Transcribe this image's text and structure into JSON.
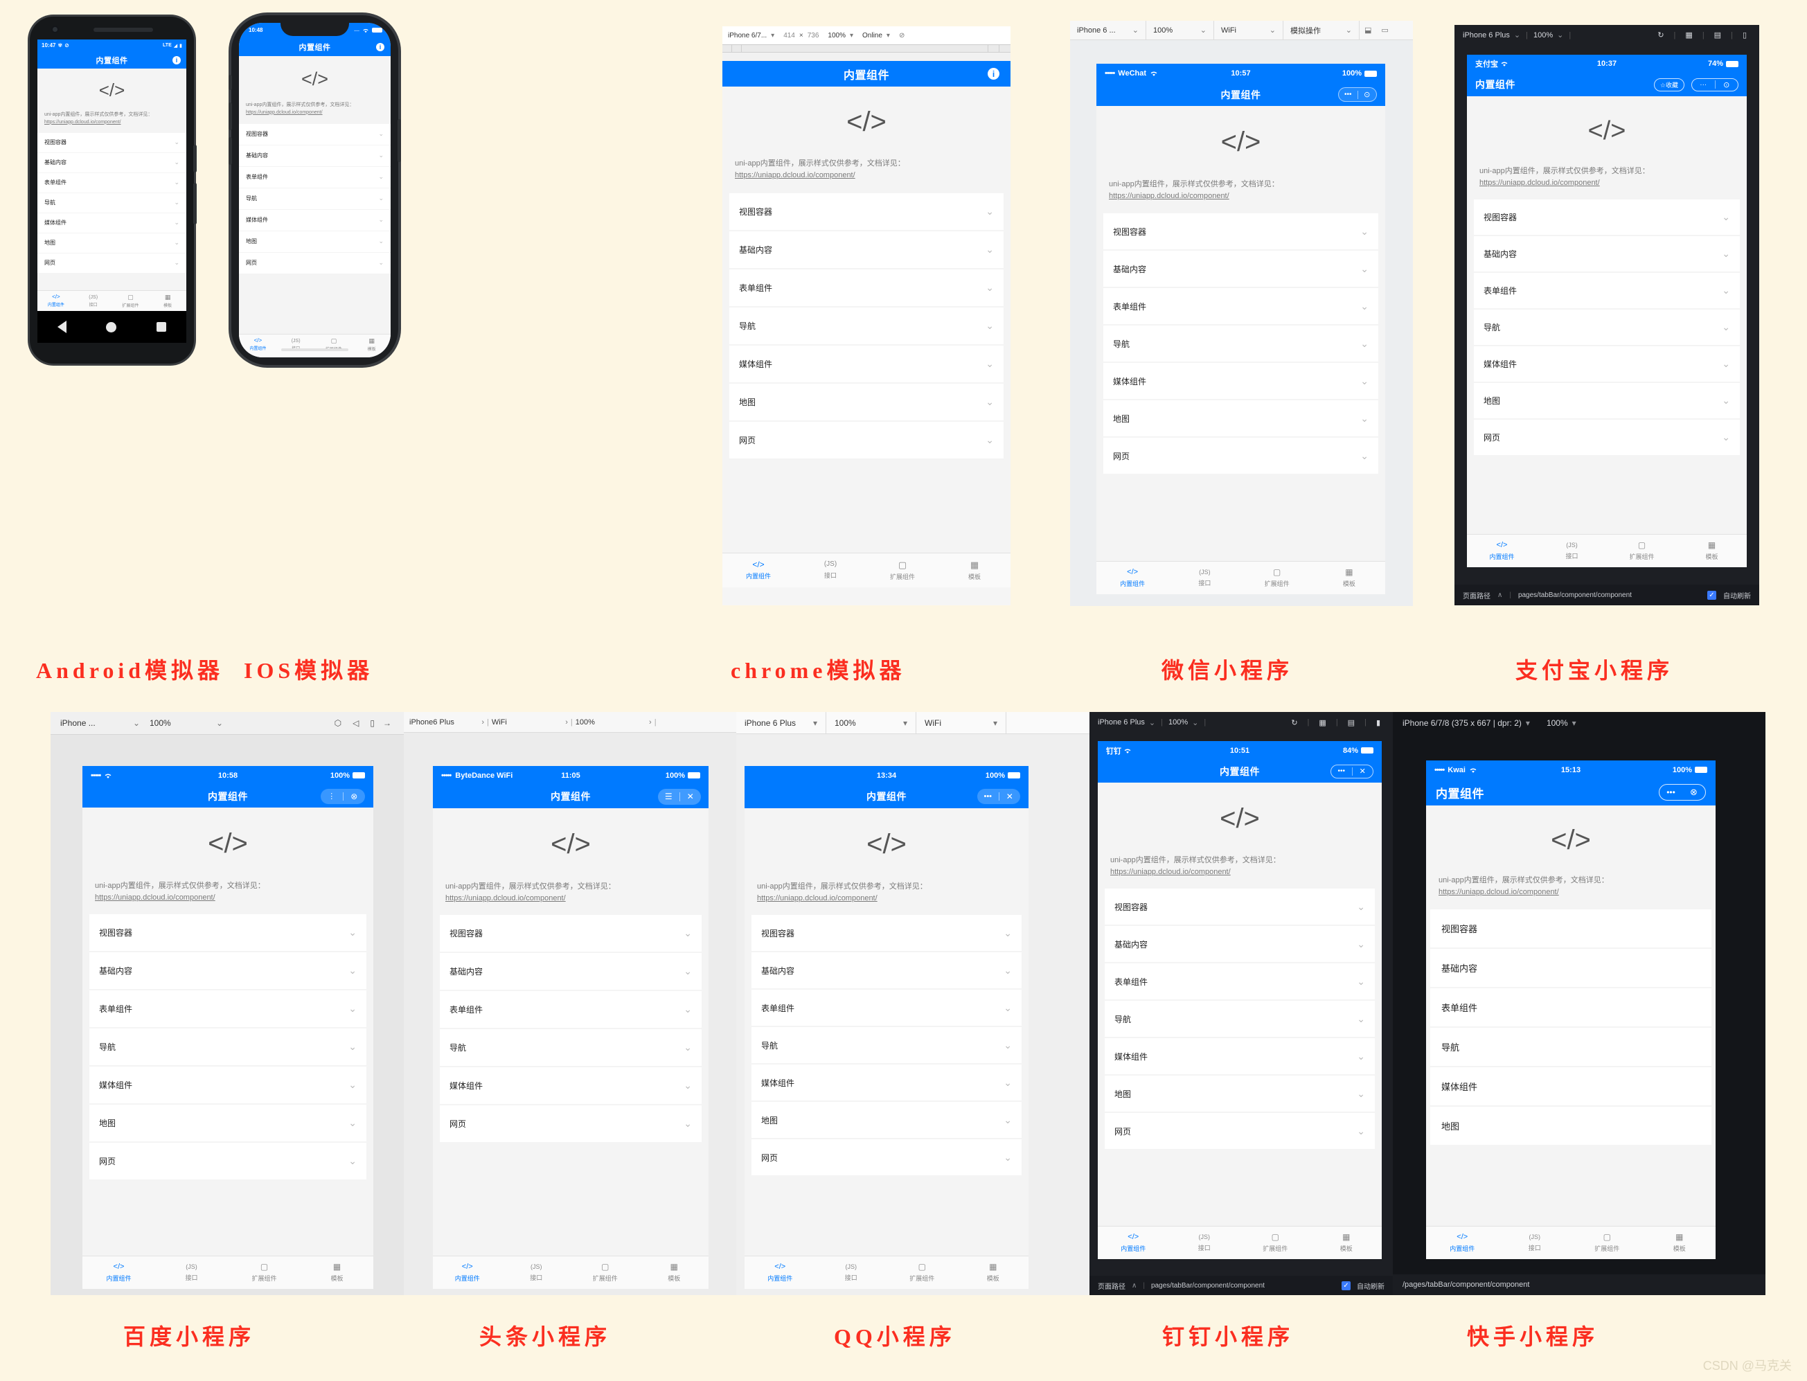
{
  "page": {
    "background": "#fdf6e3",
    "watermark": "CSDN @马克关",
    "accent": "#007AFF",
    "caption_color": "#fb2e20"
  },
  "common": {
    "app_title": "内置组件",
    "code_logo": "</>",
    "blurb_text": "uni-app内置组件，展示样式仅供参考，文档详见：",
    "blurb_link": "https://uniapp.dcloud.io/component/",
    "info_icon": "i",
    "chevron": "⌄",
    "list_items": [
      "视图容器",
      "基础内容",
      "表单组件",
      "导航",
      "媒体组件",
      "地图",
      "网页"
    ],
    "list_items_short": [
      "视图容器",
      "基础内容",
      "表单组件",
      "导航",
      "媒体组件",
      "地图"
    ],
    "tabs": [
      {
        "icon": "</>",
        "label": "内置组件",
        "active": true
      },
      {
        "icon": "(JS)",
        "label": "接口",
        "active": false
      },
      {
        "icon": "puzzle",
        "label": "扩展组件",
        "active": false
      },
      {
        "icon": "grid",
        "label": "模板",
        "active": false
      }
    ]
  },
  "captions": {
    "android": "Android模拟器",
    "ios": "IOS模拟器",
    "chrome": "chrome模拟器",
    "wechat": "微信小程序",
    "alipay": "支付宝小程序",
    "baidu": "百度小程序",
    "toutiao": "头条小程序",
    "qq": "QQ小程序",
    "dingtalk": "钉钉小程序",
    "kwai": "快手小程序"
  },
  "android": {
    "status": {
      "time": "10:47",
      "gear_icon": "✾",
      "sync_icon": "⊘",
      "network": "LTE",
      "signal_icon": "◢",
      "battery_icon": "▮"
    }
  },
  "ios": {
    "status": {
      "time": "10:48",
      "dots": "....",
      "wifi_icon": "wifi",
      "battery_icon": "▰"
    }
  },
  "chrome": {
    "toolbar": {
      "device": "iPhone 6/7...",
      "width": "414",
      "times": "×",
      "height": "736",
      "zoom": "100%",
      "network": "Online",
      "throttle_icon": "⊘"
    }
  },
  "wechat": {
    "toolbar": {
      "device": "iPhone 6 ...",
      "zoom": "100%",
      "network": "WiFi",
      "simulate": "模拟操作",
      "icon_a": "⬓",
      "icon_b": "▭"
    },
    "status": {
      "dots": "•••••",
      "carrier": "WeChat",
      "wifi_icon": "wifi",
      "time": "10:57",
      "battery": "100%",
      "battery_icon": "▰"
    },
    "capsule": {
      "more": "•••",
      "close": "⊙"
    }
  },
  "alipay": {
    "toolbar": {
      "device": "iPhone 6 Plus",
      "zoom": "100%",
      "refresh_icon": "↻",
      "grid_icon": "▦",
      "debug_icon": "▤",
      "window_icon": "▯"
    },
    "status": {
      "carrier": "支付宝",
      "wifi_icon": "wifi",
      "time": "10:37",
      "battery": "74%",
      "battery_icon": "▰"
    },
    "nav": {
      "favorite": "☆收藏",
      "more": "···",
      "close": "⊙"
    },
    "bottom": {
      "label": "页面路径",
      "caret": "∧",
      "path": "pages/tabBar/component/component",
      "refresh_label": "自动刷新",
      "checked": true
    }
  },
  "baidu": {
    "toolbar": {
      "device": "iPhone ...",
      "zoom": "100%",
      "icon_cube": "⬡",
      "icon_sound": "◁",
      "icon_phone": "▯",
      "icon_arrow": "→"
    },
    "status": {
      "dots": "•••••",
      "wifi_icon": "wifi",
      "time": "10:58",
      "battery": "100%",
      "battery_icon": "▰"
    },
    "capsule": {
      "more": "⋮",
      "close": "⊗"
    }
  },
  "toutiao": {
    "toolbar": {
      "device": "iPhone6 Plus",
      "network": "WiFi",
      "zoom": "100%",
      "sep": "›"
    },
    "status": {
      "dots": "•••••",
      "carrier": "ByteDance WiFi",
      "time": "11:05",
      "battery": "100%",
      "battery_icon": "▰"
    },
    "capsule": {
      "menu": "☰",
      "close": "✕"
    }
  },
  "qq": {
    "toolbar": {
      "device": "iPhone 6 Plus",
      "zoom": "100%",
      "network": "WiFi"
    },
    "status": {
      "time": "13:34",
      "battery": "100%",
      "battery_icon": "▰"
    },
    "capsule": {
      "more": "•••",
      "close": "✕"
    }
  },
  "dingtalk": {
    "toolbar": {
      "device": "iPhone 6 Plus",
      "zoom": "100%",
      "refresh_icon": "↻",
      "grid_icon": "▦",
      "debug_icon": "▤",
      "window_icon": "▮"
    },
    "status": {
      "carrier": "钉钉",
      "wifi_icon": "wifi",
      "time": "10:51",
      "battery": "84%",
      "battery_icon": "▰"
    },
    "capsule": {
      "more": "•••",
      "close": "✕"
    },
    "bottom": {
      "label": "页面路径",
      "caret": "∧",
      "path": "pages/tabBar/component/component",
      "refresh_label": "自动刷新",
      "checked": true
    }
  },
  "kwai": {
    "toolbar": {
      "device": "iPhone 6/7/8 (375 x 667 | dpr: 2)",
      "zoom": "100%"
    },
    "status": {
      "dots": "•••••",
      "carrier": "Kwai",
      "wifi_icon": "wifi",
      "time": "15:13",
      "battery": "100%",
      "battery_icon": "▰"
    },
    "capsule": {
      "more": "•••",
      "close": "⊗"
    },
    "bottom": {
      "path": "/pages/tabBar/component/component"
    }
  }
}
